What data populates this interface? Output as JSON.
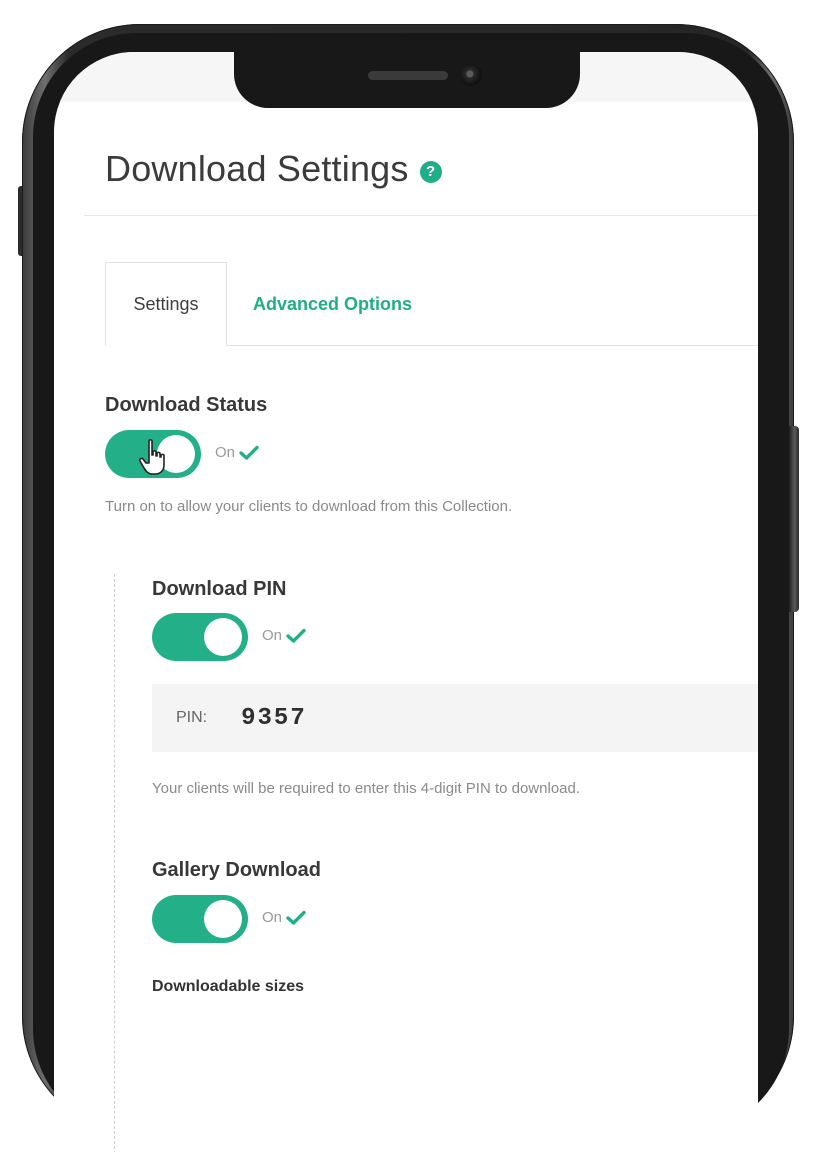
{
  "page": {
    "title": "Download Settings",
    "help_icon": "question-circle-icon"
  },
  "tabs": [
    {
      "label": "Settings",
      "active": true
    },
    {
      "label": "Advanced Options",
      "active": false
    }
  ],
  "download_status": {
    "label": "Download Status",
    "toggle_state": "On",
    "help": "Turn on to allow your clients to download from this Collection."
  },
  "download_pin": {
    "label": "Download PIN",
    "toggle_state": "On",
    "pin_label": "PIN:",
    "pin_value": "9357",
    "help": "Your clients will be required to enter this 4-digit PIN to download."
  },
  "gallery_download": {
    "label": "Gallery Download",
    "toggle_state": "On",
    "sizes_label": "Downloadable sizes"
  },
  "colors": {
    "accent": "#23b088",
    "text": "#3b3b3b",
    "muted": "#8a8a8a"
  }
}
